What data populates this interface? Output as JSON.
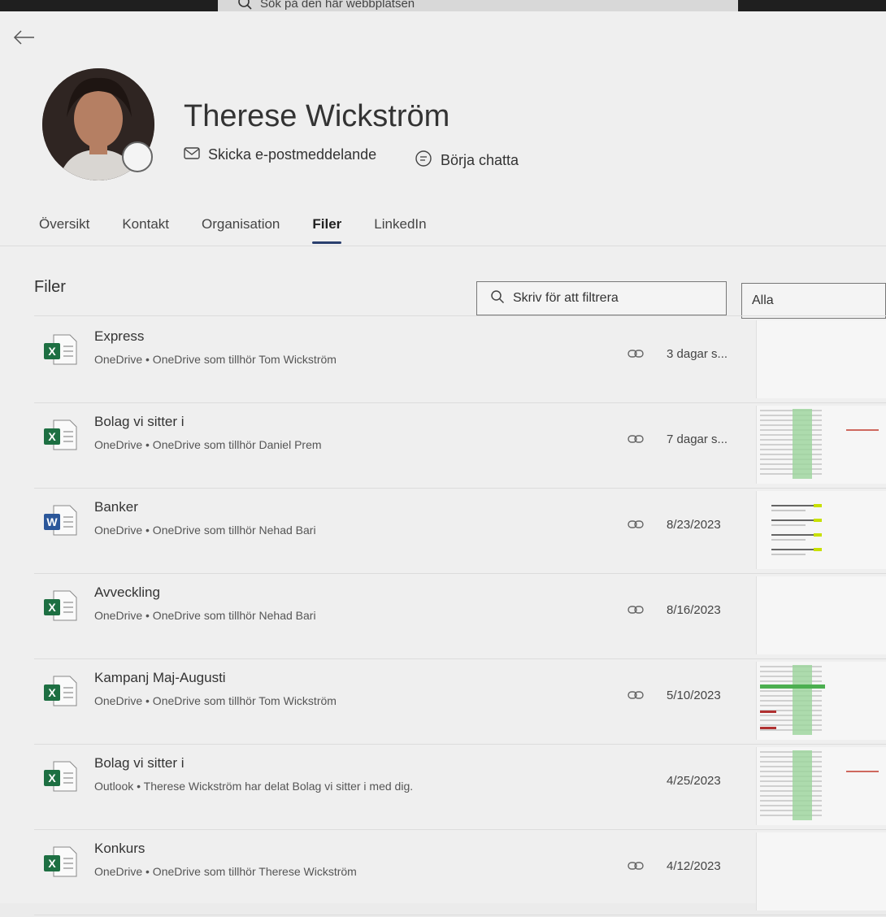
{
  "topbar": {
    "search_placeholder": "Sök på den här webbplatsen"
  },
  "profile": {
    "name": "Therese Wickström",
    "email_action": "Skicka e-postmeddelande",
    "chat_action": "Börja chatta"
  },
  "tabs": [
    {
      "label": "Översikt",
      "active": false
    },
    {
      "label": "Kontakt",
      "active": false
    },
    {
      "label": "Organisation",
      "active": false
    },
    {
      "label": "Filer",
      "active": true
    },
    {
      "label": "LinkedIn",
      "active": false
    }
  ],
  "files_section": {
    "title": "Filer",
    "filter_placeholder": "Skriv för att filtrera",
    "dropdown_value": "Alla"
  },
  "files": [
    {
      "type": "excel",
      "name": "Express",
      "subtitle": "OneDrive • OneDrive som tillhör Tom Wickström",
      "date": "3 dagar s...",
      "shared_link": true,
      "thumb": "blank"
    },
    {
      "type": "excel",
      "name": "Bolag vi sitter i",
      "subtitle": "OneDrive • OneDrive som tillhör Daniel Prem",
      "date": "7 dagar s...",
      "shared_link": true,
      "thumb": "sheet-green"
    },
    {
      "type": "word",
      "name": "Banker",
      "subtitle": "OneDrive • OneDrive som tillhör Nehad Bari",
      "date": "8/23/2023",
      "shared_link": true,
      "thumb": "doc-lines"
    },
    {
      "type": "excel",
      "name": "Avveckling",
      "subtitle": "OneDrive • OneDrive som tillhör Nehad Bari",
      "date": "8/16/2023",
      "shared_link": true,
      "thumb": "blank"
    },
    {
      "type": "excel",
      "name": "Kampanj Maj-Augusti",
      "subtitle": "OneDrive • OneDrive som tillhör Tom Wickström",
      "date": "5/10/2023",
      "shared_link": true,
      "thumb": "sheet-mixed"
    },
    {
      "type": "excel",
      "name": "Bolag vi sitter i",
      "subtitle": "Outlook • Therese Wickström har delat Bolag vi sitter i med dig.",
      "date": "4/25/2023",
      "shared_link": false,
      "thumb": "sheet-green"
    },
    {
      "type": "excel",
      "name": "Konkurs",
      "subtitle": "OneDrive • OneDrive som tillhör Therese Wickström",
      "date": "4/12/2023",
      "shared_link": true,
      "thumb": "blank"
    }
  ],
  "colors": {
    "excel": "#1d6f42",
    "word": "#2b579a",
    "tab_underline": "#2a3f6e"
  }
}
